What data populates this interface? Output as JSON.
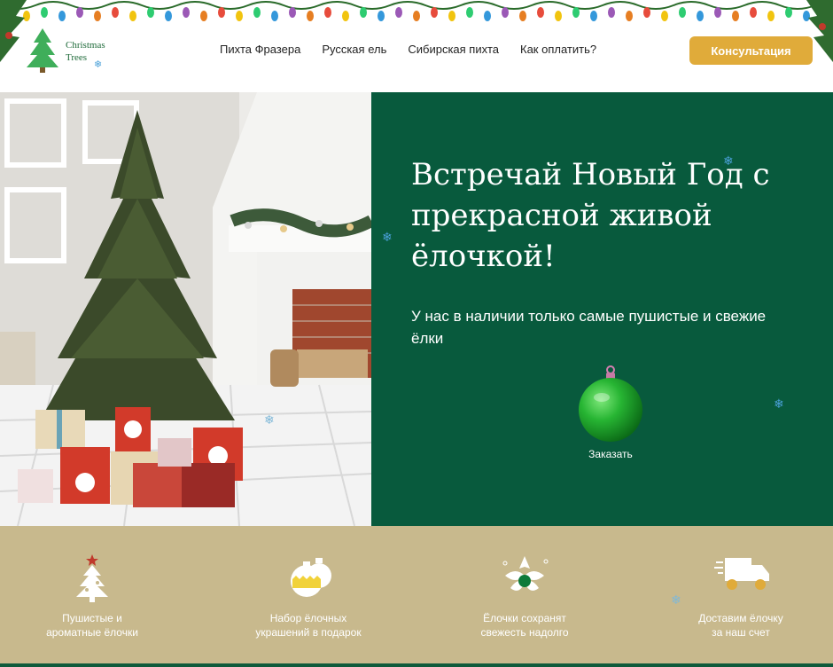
{
  "header": {
    "logo_line1": "Christmas",
    "logo_line2": "Trees",
    "nav": [
      {
        "label": "Пихта Фразера"
      },
      {
        "label": "Русская ель"
      },
      {
        "label": "Сибирская пихта"
      },
      {
        "label": "Как оплатить?"
      }
    ],
    "consult_label": "Консультация"
  },
  "hero": {
    "title": "Встречай Новый Год с прекрасной живой ёлочкой!",
    "subtitle": "У нас в наличии только самые пушистые и свежие ёлки",
    "order_label": "Заказать"
  },
  "features": [
    {
      "line1": "Пушистые и",
      "line2": "ароматные ёлочки",
      "icon": "decorated-tree-icon"
    },
    {
      "line1": "Набор ёлочных",
      "line2": "украшений в подарок",
      "icon": "ornaments-icon"
    },
    {
      "line1": "Ёлочки сохранят",
      "line2": "свежесть надолго",
      "icon": "leaf-fresh-icon"
    },
    {
      "line1": "Доставим ёлочку",
      "line2": "за наш счет",
      "icon": "delivery-truck-icon"
    }
  ],
  "colors": {
    "hero_green": "#085a3d",
    "accent_gold": "#e0ab3a",
    "features_bg": "#c8b98d"
  }
}
